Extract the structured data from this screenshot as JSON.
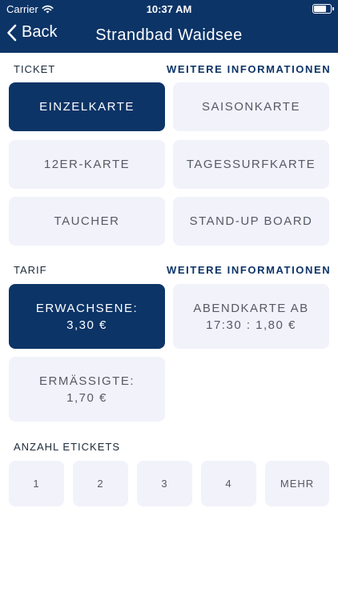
{
  "status_bar": {
    "carrier": "Carrier",
    "time": "10:37 AM",
    "wifi_icon": "wifi-icon",
    "battery_icon": "battery-icon"
  },
  "nav": {
    "back_label": "Back",
    "title": "Strandbad Waidsee"
  },
  "ticket_section": {
    "label": "TICKET",
    "info_link": "WEITERE INFORMATIONEN",
    "options": [
      {
        "label": "EINZELKARTE",
        "selected": true
      },
      {
        "label": "SAISONKARTE",
        "selected": false
      },
      {
        "label": "12ER-KARTE",
        "selected": false
      },
      {
        "label": "TAGESSURFKARTE",
        "selected": false
      },
      {
        "label": "TAUCHER",
        "selected": false
      },
      {
        "label": "STAND-UP BOARD",
        "selected": false
      }
    ]
  },
  "tarif_section": {
    "label": "TARIF",
    "info_link": "WEITERE INFORMATIONEN",
    "options": [
      {
        "line1": "ERWACHSENE:",
        "line2": "3,30 €",
        "selected": true
      },
      {
        "line1": "ABENDKARTE AB",
        "line2": "17:30 : 1,80 €",
        "selected": false
      },
      {
        "line1": "ERMÄSSIGTE:",
        "line2": "1,70 €",
        "selected": false
      }
    ]
  },
  "count_section": {
    "label": "ANZAHL ETICKETS",
    "options": [
      "1",
      "2",
      "3",
      "4",
      "MEHR"
    ]
  },
  "colors": {
    "primary": "#0c3467",
    "tile_background": "#f1f2fa",
    "tile_text": "#555a63"
  }
}
